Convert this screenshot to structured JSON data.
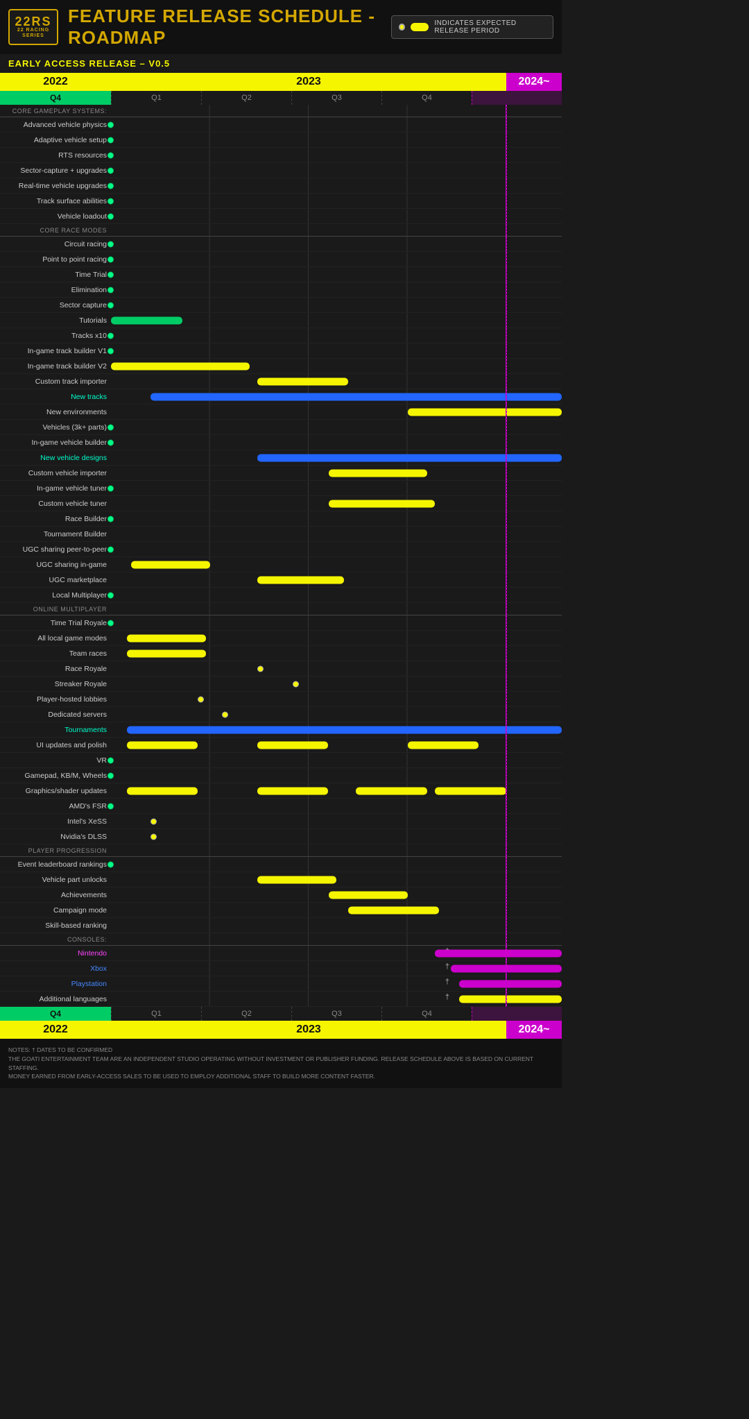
{
  "header": {
    "logo_line1": "22RS",
    "logo_line2": "22 RACING SERIES",
    "title": "FEATURE RELEASE SCHEDULE - ROADMAP"
  },
  "legend": {
    "text": "INDICATES EXPECTED RELEASE PERIOD"
  },
  "early_access": "EARLY ACCESS RELEASE – V0.5",
  "years": {
    "y2022": "2022",
    "y2023": "2023",
    "y2024": "2024~"
  },
  "quarters": {
    "q2022": "Q4",
    "q1": "Q1",
    "q2": "Q2",
    "q3": "Q3",
    "q4": "Q4"
  },
  "rows": [
    {
      "label": "CORE GAMEPLAY SYSTEMS:",
      "type": "section"
    },
    {
      "label": "Advanced vehicle physics",
      "dot": true,
      "dot_pos": "q4"
    },
    {
      "label": "Adaptive vehicle setup",
      "dot": true,
      "dot_pos": "q4"
    },
    {
      "label": "RTS resources",
      "dot": true,
      "dot_pos": "q4"
    },
    {
      "label": "Sector-capture + upgrades",
      "dot": true,
      "dot_pos": "q4"
    },
    {
      "label": "Real-time vehicle upgrades",
      "dot": true,
      "dot_pos": "q4"
    },
    {
      "label": "Track surface abilities",
      "dot": true,
      "dot_pos": "q4"
    },
    {
      "label": "Vehicle loadout",
      "dot": true,
      "dot_pos": "q4"
    },
    {
      "label": "CORE RACE MODES",
      "type": "section"
    },
    {
      "label": "Circuit racing",
      "dot": true,
      "dot_pos": "q4"
    },
    {
      "label": "Point to point racing",
      "dot": true,
      "dot_pos": "q4"
    },
    {
      "label": "Time Trial",
      "dot": true,
      "dot_pos": "q4"
    },
    {
      "label": "Elimination",
      "dot": true,
      "dot_pos": "q4"
    },
    {
      "label": "Sector capture",
      "dot": true,
      "dot_pos": "q4"
    },
    {
      "label": "Tutorials",
      "bar": true,
      "bar_color": "green",
      "bar_start": 0,
      "bar_width": 0.18
    },
    {
      "label": "Tracks x10",
      "dot": true,
      "dot_pos": "q4"
    },
    {
      "label": "In-game track builder V1",
      "dot": true,
      "dot_pos": "q4"
    },
    {
      "label": "In-game track builder V2",
      "bar": true,
      "bar_color": "yellow",
      "bar_start": 0,
      "bar_width": 0.35
    },
    {
      "label": "Custom track importer",
      "bar": true,
      "bar_color": "yellow",
      "bar_start": 0.37,
      "bar_width": 0.23
    },
    {
      "label": "New tracks",
      "type": "cyan",
      "bar": true,
      "bar_color": "blue",
      "bar_start": 0.1,
      "bar_width": 0.9,
      "extends_2024": true
    },
    {
      "label": "New environments",
      "bar": true,
      "bar_color": "yellow",
      "bar_start": 0.75,
      "bar_width": 0.25,
      "extends_2024": true
    },
    {
      "label": "Vehicles (3k+ parts)",
      "dot": true,
      "dot_pos": "q4"
    },
    {
      "label": "In-game vehicle builder",
      "dot": true,
      "dot_pos": "q4"
    },
    {
      "label": "New vehicle designs",
      "type": "cyan",
      "bar": true,
      "bar_color": "blue",
      "bar_start": 0.37,
      "bar_width": 0.38,
      "extends_2024": true,
      "bar2_start": 0.8,
      "bar2_width": 0.2
    },
    {
      "label": "Custom vehicle importer",
      "bar": true,
      "bar_color": "yellow",
      "bar_start": 0.55,
      "bar_width": 0.25
    },
    {
      "label": "In-game vehicle tuner",
      "dot": true,
      "dot_pos": "q4"
    },
    {
      "label": "Custom vehicle tuner",
      "bar": true,
      "bar_color": "yellow",
      "bar_start": 0.55,
      "bar_width": 0.27
    },
    {
      "label": "Race Builder",
      "dot": true,
      "dot_pos": "q4"
    },
    {
      "label": "Tournament Builder",
      "bar": false
    },
    {
      "label": "UGC sharing peer-to-peer",
      "dot": true,
      "dot_pos": "q4"
    },
    {
      "label": "UGC sharing in-game",
      "bar": true,
      "bar_color": "yellow",
      "bar_start": 0.05,
      "bar_width": 0.2
    },
    {
      "label": "UGC marketplace",
      "bar": true,
      "bar_color": "yellow",
      "bar_start": 0.37,
      "bar_width": 0.22
    },
    {
      "label": "Local Multiplayer",
      "dot": true,
      "dot_pos": "q4"
    },
    {
      "label": "ONLINE MULTIPLAYER",
      "type": "section"
    },
    {
      "label": "Time Trial Royale",
      "dot": true,
      "dot_pos": "q4"
    },
    {
      "label": "All local game modes",
      "bar": true,
      "bar_color": "yellow",
      "bar_start": 0.04,
      "bar_width": 0.2
    },
    {
      "label": "Team races",
      "bar": true,
      "bar_color": "yellow",
      "bar_start": 0.04,
      "bar_width": 0.2
    },
    {
      "label": "Race Royale",
      "dot_yellow": true,
      "dot_pos": "q2mid"
    },
    {
      "label": "Streaker Royale",
      "dot_yellow": true,
      "dot_pos": "q2far"
    },
    {
      "label": "Player-hosted lobbies",
      "dot_yellow": true,
      "dot_pos": "q1far"
    },
    {
      "label": "Dedicated servers",
      "dot_yellow": true,
      "dot_pos": "q2near"
    },
    {
      "label": "Tournaments",
      "type": "cyan",
      "bar": true,
      "bar_color": "blue",
      "bar_start": 0.04,
      "bar_width": 0.96,
      "extends_2024": true
    },
    {
      "label": "UI updates and polish",
      "bar": true,
      "bar_color": "yellow",
      "bar_start": 0.04,
      "bar_width": 0.18,
      "bar2": true,
      "bar2_start": 0.37,
      "bar2_width": 0.18,
      "bar3": true,
      "bar3_start": 0.75,
      "bar3_width": 0.18
    },
    {
      "label": "VR",
      "dot": true,
      "dot_pos": "q4"
    },
    {
      "label": "Gamepad, KB/M, Wheels",
      "dot": true,
      "dot_pos": "q4"
    },
    {
      "label": "Graphics/shader updates",
      "bar": true,
      "bar_color": "yellow",
      "bar_start": 0.04,
      "bar_width": 0.18,
      "bar2": true,
      "bar2_start": 0.37,
      "bar2_width": 0.18,
      "bar3": true,
      "bar3_start": 0.62,
      "bar3_width": 0.18,
      "bar4": true,
      "bar4_start": 0.82,
      "bar4_width": 0.18
    },
    {
      "label": "AMD's FSR",
      "dot": true,
      "dot_pos": "q4"
    },
    {
      "label": "Intel's XeSS",
      "dot_yellow": true,
      "dot_pos": "q1mid"
    },
    {
      "label": "Nvidia's DLSS",
      "dot_yellow": true,
      "dot_pos": "q1mid"
    },
    {
      "label": "PLAYER PROGRESSION",
      "type": "section"
    },
    {
      "label": "Event leaderboard rankings",
      "dot": true,
      "dot_pos": "q4"
    },
    {
      "label": "Vehicle part unlocks",
      "bar": true,
      "bar_color": "yellow",
      "bar_start": 0.37,
      "bar_width": 0.2
    },
    {
      "label": "Achievements",
      "bar": true,
      "bar_color": "yellow",
      "bar_start": 0.55,
      "bar_width": 0.2
    },
    {
      "label": "Campaign mode",
      "bar": true,
      "bar_color": "yellow",
      "bar_start": 0.6,
      "bar_width": 0.23
    },
    {
      "label": "Skill-based ranking",
      "bar": false
    },
    {
      "label": "CONSOLES:",
      "type": "section"
    },
    {
      "label": "Nintendo",
      "type": "magenta",
      "dagger": true,
      "bar": true,
      "bar_color": "magenta",
      "bar_start": 0.82,
      "bar_width": 0.18,
      "extends_2024": true
    },
    {
      "label": "Xbox",
      "type": "blue_label",
      "dagger": true,
      "bar": true,
      "bar_color": "magenta",
      "bar_start": 0.86,
      "bar_width": 0.14,
      "extends_2024": true
    },
    {
      "label": "Playstation",
      "type": "blue_label",
      "dagger": true,
      "bar": true,
      "bar_color": "magenta",
      "bar_start": 0.88,
      "bar_width": 0.12,
      "extends_2024": true
    },
    {
      "label": "Additional languages",
      "dagger": true,
      "bar": true,
      "bar_color": "yellow",
      "bar_start": 0.88,
      "bar_width": 0.12,
      "extends_2024": true
    }
  ],
  "footer_notes": {
    "line1": "NOTES: † DATES TO BE CONFIRMED",
    "line2": "THE GOATI ENTERTAINMENT TEAM ARE AN INDEPENDENT STUDIO OPERATING WITHOUT INVESTMENT OR PUBLISHER FUNDING. RELEASE SCHEDULE ABOVE IS BASED ON CURRENT STAFFING.",
    "line3": "MONEY EARNED FROM EARLY-ACCESS SALES TO BE USED TO EMPLOY ADDITIONAL STAFF TO BUILD MORE CONTENT FASTER."
  }
}
